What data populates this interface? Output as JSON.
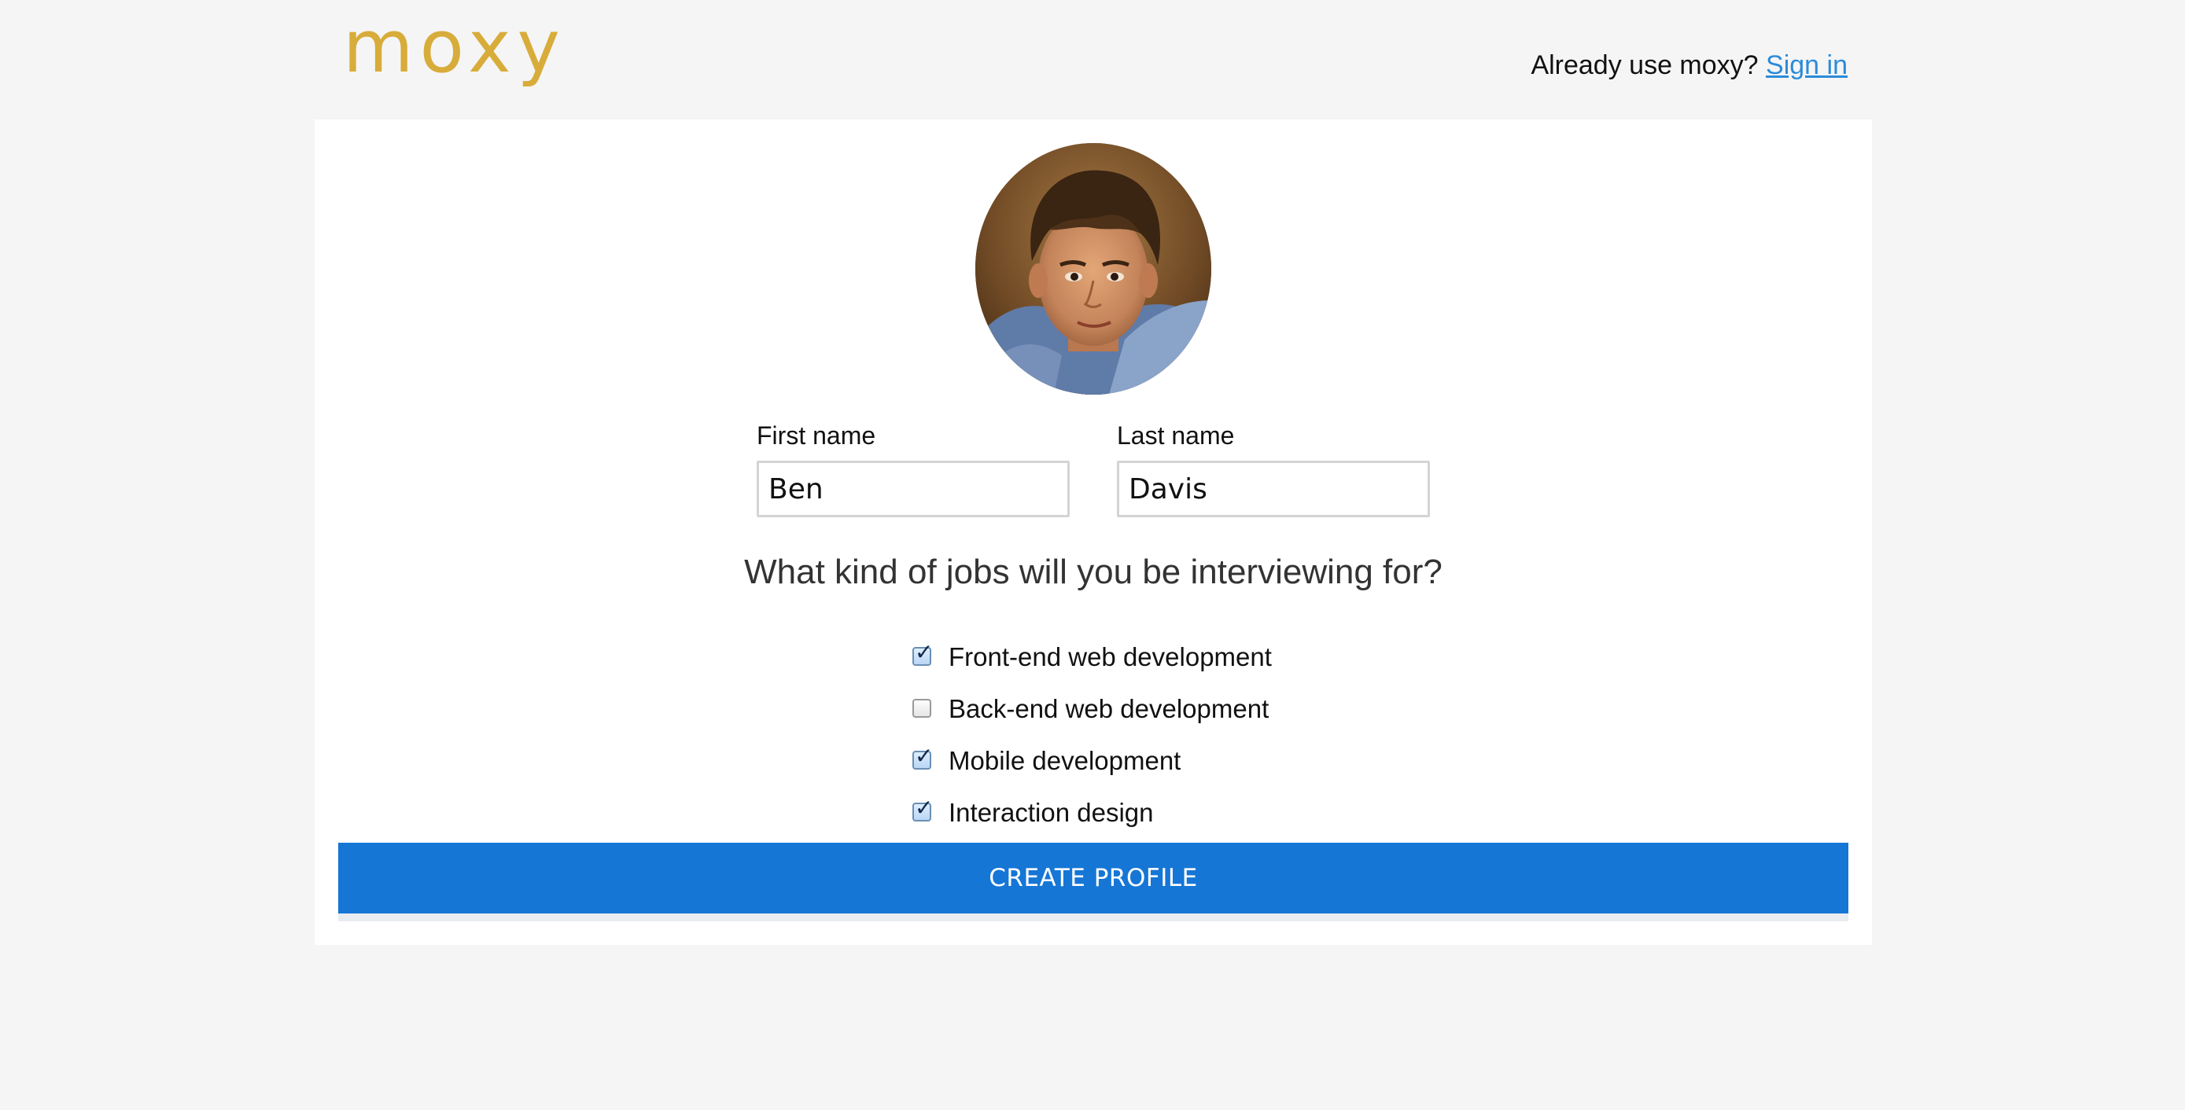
{
  "header": {
    "logo": "moxy",
    "already_text": "Already use moxy? ",
    "signin_link": "Sign in"
  },
  "profile": {
    "avatar_icon": "user-photo",
    "first_name": {
      "label": "First name",
      "value": "Ben"
    },
    "last_name": {
      "label": "Last name",
      "value": "Davis"
    }
  },
  "jobs": {
    "question": "What kind of jobs will you be interviewing for?",
    "options": [
      {
        "label": "Front-end web development",
        "checked": true
      },
      {
        "label": "Back-end web development",
        "checked": false
      },
      {
        "label": "Mobile development",
        "checked": true
      },
      {
        "label": "Interaction design",
        "checked": true
      }
    ]
  },
  "actions": {
    "create_button": "CREATE PROFILE"
  },
  "colors": {
    "logo": "#d8ac3a",
    "link": "#2b8bd9",
    "primary_button": "#1576d6",
    "page_background": "#f5f5f5"
  }
}
